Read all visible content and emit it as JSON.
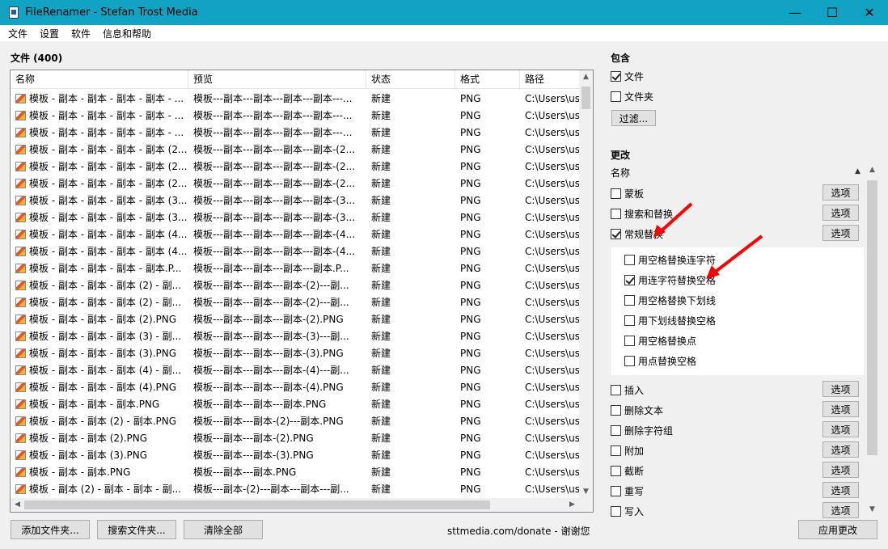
{
  "window": {
    "title": "FileRenamer - Stefan Trost Media",
    "minimize": "—",
    "maximize": "☐",
    "close": "✕"
  },
  "menu": [
    "文件",
    "设置",
    "软件",
    "信息和帮助"
  ],
  "files_section": {
    "title": "文件 (400)",
    "columns": [
      "名称",
      "预览",
      "状态",
      "格式",
      "路径"
    ],
    "rows": [
      {
        "name": "模板 - 副本 - 副本 - 副本 - 副本 - ...",
        "preview": "模板---副本---副本---副本---副本---...",
        "status": "新建",
        "format": "PNG",
        "path": "C:\\Users\\us"
      },
      {
        "name": "模板 - 副本 - 副本 - 副本 - 副本 - ...",
        "preview": "模板---副本---副本---副本---副本---...",
        "status": "新建",
        "format": "PNG",
        "path": "C:\\Users\\us"
      },
      {
        "name": "模板 - 副本 - 副本 - 副本 - 副本 - ...",
        "preview": "模板---副本---副本---副本---副本---...",
        "status": "新建",
        "format": "PNG",
        "path": "C:\\Users\\us"
      },
      {
        "name": "模板 - 副本 - 副本 - 副本 - 副本 (2...",
        "preview": "模板---副本---副本---副本---副本-(2...",
        "status": "新建",
        "format": "PNG",
        "path": "C:\\Users\\us"
      },
      {
        "name": "模板 - 副本 - 副本 - 副本 - 副本 (2...",
        "preview": "模板---副本---副本---副本---副本-(2...",
        "status": "新建",
        "format": "PNG",
        "path": "C:\\Users\\us"
      },
      {
        "name": "模板 - 副本 - 副本 - 副本 - 副本 (2...",
        "preview": "模板---副本---副本---副本---副本-(2...",
        "status": "新建",
        "format": "PNG",
        "path": "C:\\Users\\us"
      },
      {
        "name": "模板 - 副本 - 副本 - 副本 - 副本 (3...",
        "preview": "模板---副本---副本---副本---副本-(3...",
        "status": "新建",
        "format": "PNG",
        "path": "C:\\Users\\us"
      },
      {
        "name": "模板 - 副本 - 副本 - 副本 - 副本 (3...",
        "preview": "模板---副本---副本---副本---副本-(3...",
        "status": "新建",
        "format": "PNG",
        "path": "C:\\Users\\us"
      },
      {
        "name": "模板 - 副本 - 副本 - 副本 - 副本 (4...",
        "preview": "模板---副本---副本---副本---副本-(4...",
        "status": "新建",
        "format": "PNG",
        "path": "C:\\Users\\us"
      },
      {
        "name": "模板 - 副本 - 副本 - 副本 - 副本 (4...",
        "preview": "模板---副本---副本---副本---副本-(4...",
        "status": "新建",
        "format": "PNG",
        "path": "C:\\Users\\us"
      },
      {
        "name": "模板 - 副本 - 副本 - 副本 - 副本.P...",
        "preview": "模板---副本---副本---副本---副本.P...",
        "status": "新建",
        "format": "PNG",
        "path": "C:\\Users\\us"
      },
      {
        "name": "模板 - 副本 - 副本 - 副本 (2) - 副...",
        "preview": "模板---副本---副本---副本-(2)---副...",
        "status": "新建",
        "format": "PNG",
        "path": "C:\\Users\\us"
      },
      {
        "name": "模板 - 副本 - 副本 - 副本 (2) - 副...",
        "preview": "模板---副本---副本---副本-(2)---副...",
        "status": "新建",
        "format": "PNG",
        "path": "C:\\Users\\us"
      },
      {
        "name": "模板 - 副本 - 副本 - 副本 (2).PNG",
        "preview": "模板---副本---副本---副本-(2).PNG",
        "status": "新建",
        "format": "PNG",
        "path": "C:\\Users\\us"
      },
      {
        "name": "模板 - 副本 - 副本 - 副本 (3) - 副...",
        "preview": "模板---副本---副本---副本-(3)---副...",
        "status": "新建",
        "format": "PNG",
        "path": "C:\\Users\\us"
      },
      {
        "name": "模板 - 副本 - 副本 - 副本 (3).PNG",
        "preview": "模板---副本---副本---副本-(3).PNG",
        "status": "新建",
        "format": "PNG",
        "path": "C:\\Users\\us"
      },
      {
        "name": "模板 - 副本 - 副本 - 副本 (4) - 副...",
        "preview": "模板---副本---副本---副本-(4)---副...",
        "status": "新建",
        "format": "PNG",
        "path": "C:\\Users\\us"
      },
      {
        "name": "模板 - 副本 - 副本 - 副本 (4).PNG",
        "preview": "模板---副本---副本---副本-(4).PNG",
        "status": "新建",
        "format": "PNG",
        "path": "C:\\Users\\us"
      },
      {
        "name": "模板 - 副本 - 副本 - 副本.PNG",
        "preview": "模板---副本---副本---副本.PNG",
        "status": "新建",
        "format": "PNG",
        "path": "C:\\Users\\us"
      },
      {
        "name": "模板 - 副本 - 副本 (2) - 副本.PNG",
        "preview": "模板---副本---副本-(2)---副本.PNG",
        "status": "新建",
        "format": "PNG",
        "path": "C:\\Users\\us"
      },
      {
        "name": "模板 - 副本 - 副本 (2).PNG",
        "preview": "模板---副本---副本-(2).PNG",
        "status": "新建",
        "format": "PNG",
        "path": "C:\\Users\\us"
      },
      {
        "name": "模板 - 副本 - 副本 (3).PNG",
        "preview": "模板---副本---副本-(3).PNG",
        "status": "新建",
        "format": "PNG",
        "path": "C:\\Users\\us"
      },
      {
        "name": "模板 - 副本 - 副本.PNG",
        "preview": "模板---副本---副本.PNG",
        "status": "新建",
        "format": "PNG",
        "path": "C:\\Users\\us"
      },
      {
        "name": "模板 - 副本 (2) - 副本 - 副本 - 副...",
        "preview": "模板---副本-(2)---副本---副本---副...",
        "status": "新建",
        "format": "PNG",
        "path": "C:\\Users\\us"
      }
    ]
  },
  "bottom_bar": {
    "add_folder": "添加文件夹...",
    "search_folder": "搜索文件夹...",
    "clear_all": "清除全部",
    "donate": "sttmedia.com/donate - 谢谢您",
    "apply": "应用更改"
  },
  "include": {
    "title": "包含",
    "files_label": "文件",
    "files_checked": true,
    "folders_label": "文件夹",
    "folders_checked": false,
    "filter_button": "过滤..."
  },
  "change": {
    "title": "更改",
    "name_label": "名称",
    "option_button": "选项",
    "items_top": [
      {
        "label": "蒙板",
        "checked": false
      },
      {
        "label": "搜索和替换",
        "checked": false
      },
      {
        "label": "常规替换",
        "checked": true
      }
    ],
    "sub_options": [
      {
        "label": "用空格替换连字符",
        "checked": false
      },
      {
        "label": "用连字符替换空格",
        "checked": true
      },
      {
        "label": "用空格替换下划线",
        "checked": false
      },
      {
        "label": "用下划线替换空格",
        "checked": false
      },
      {
        "label": "用空格替换点",
        "checked": false
      },
      {
        "label": "用点替换空格",
        "checked": false
      }
    ],
    "items_bottom": [
      {
        "label": "插入",
        "checked": false
      },
      {
        "label": "删除文本",
        "checked": false
      },
      {
        "label": "删除字符组",
        "checked": false
      },
      {
        "label": "附加",
        "checked": false
      },
      {
        "label": "截断",
        "checked": false
      },
      {
        "label": "重写",
        "checked": false
      },
      {
        "label": "写入",
        "checked": false
      }
    ]
  },
  "colors": {
    "titlebar": "#12a2c4",
    "annotation_arrow": "#ff0000"
  }
}
